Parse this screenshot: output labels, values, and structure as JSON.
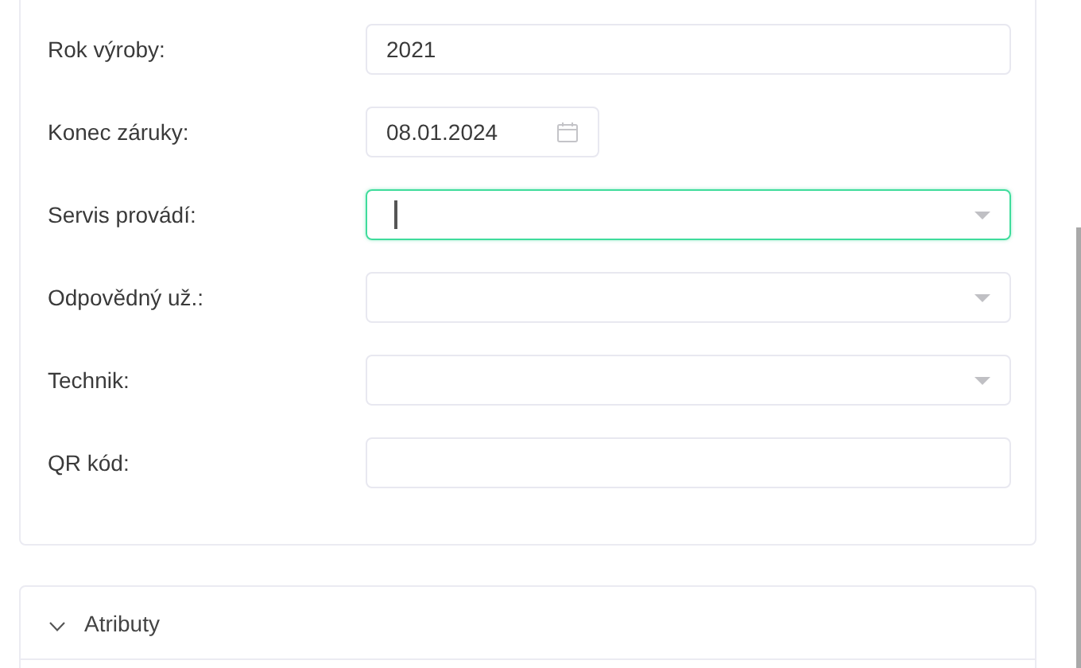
{
  "form": {
    "fields": [
      {
        "label": "Rok výroby:",
        "kind": "text",
        "value": "2021",
        "focused": false
      },
      {
        "label": "Konec záruky:",
        "kind": "date",
        "value": "08.01.2024",
        "focused": false
      },
      {
        "label": "Servis provádí:",
        "kind": "select",
        "focused": true
      },
      {
        "label": "Odpovědný už.:",
        "kind": "select",
        "focused": false
      },
      {
        "label": "Technik:",
        "kind": "select",
        "focused": false
      },
      {
        "label": "QR kód:",
        "kind": "text",
        "focused": false
      }
    ]
  },
  "sections": [
    {
      "title": "Atributy",
      "expanded": true
    }
  ]
}
